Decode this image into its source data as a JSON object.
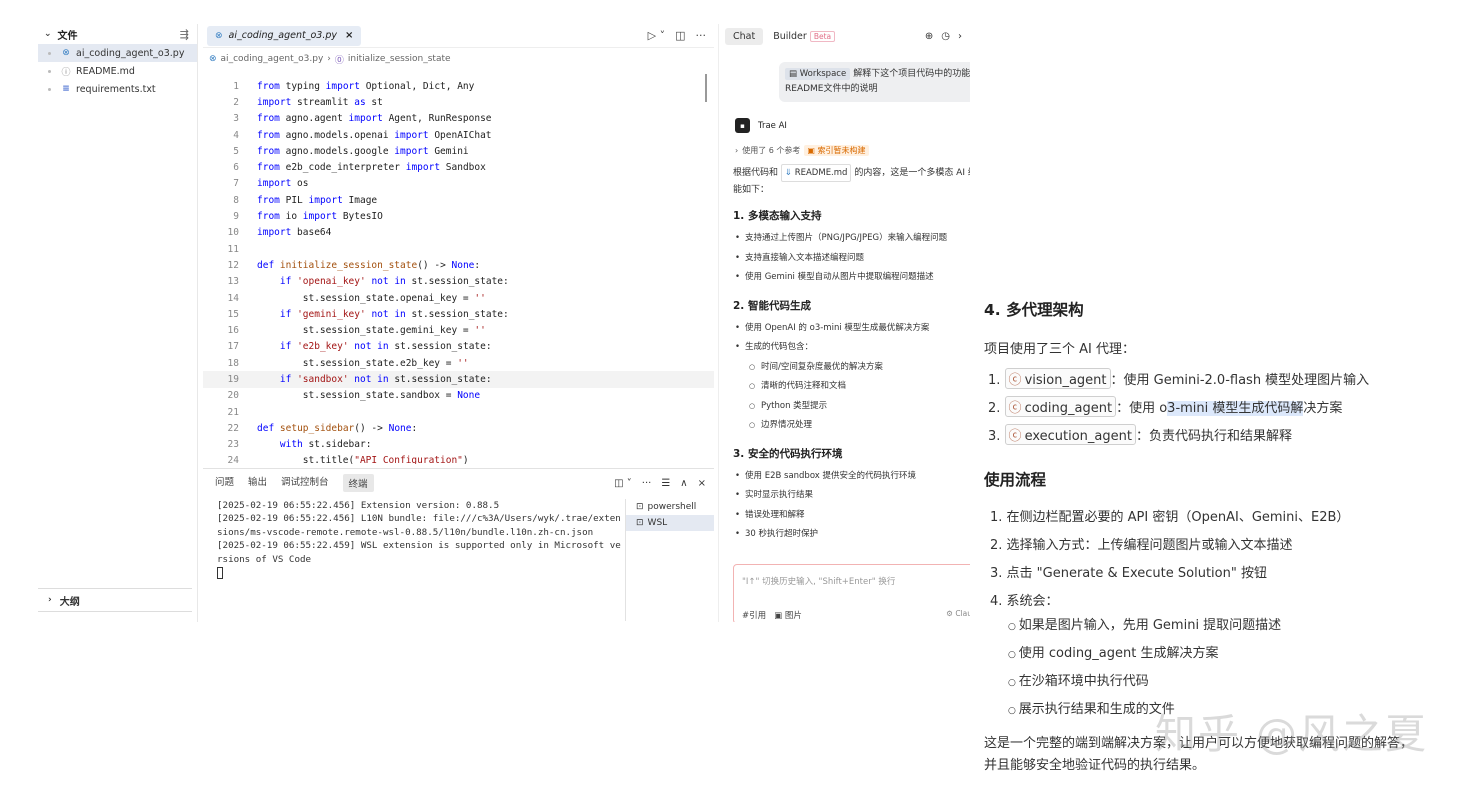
{
  "explorer": {
    "section_title": "文件",
    "files": [
      {
        "name": "ai_coding_agent_o3.py",
        "icon": "python-icon",
        "glyph": "⊗",
        "selected": true
      },
      {
        "name": "README.md",
        "icon": "info-icon",
        "glyph": "ⓘ",
        "selected": false
      },
      {
        "name": "requirements.txt",
        "icon": "text-file-icon",
        "glyph": "≡",
        "selected": false
      }
    ],
    "outline_label": "大纲"
  },
  "editor": {
    "tab_label": "ai_coding_agent_o3.py",
    "breadcrumb": {
      "file": "ai_coding_agent_o3.py",
      "symbol": "initialize_session_state"
    },
    "code_lines": [
      [
        {
          "t": "from",
          "c": "#0000ff"
        },
        {
          "t": " typing ",
          "c": "#222"
        },
        {
          "t": "import",
          "c": "#0000ff"
        },
        {
          "t": " Optional, Dict, Any",
          "c": "#222"
        }
      ],
      [
        {
          "t": "import",
          "c": "#0000ff"
        },
        {
          "t": " streamlit ",
          "c": "#222"
        },
        {
          "t": "as",
          "c": "#0000ff"
        },
        {
          "t": " st",
          "c": "#222"
        }
      ],
      [
        {
          "t": "from",
          "c": "#0000ff"
        },
        {
          "t": " agno.agent ",
          "c": "#222"
        },
        {
          "t": "import",
          "c": "#0000ff"
        },
        {
          "t": " Agent, RunResponse",
          "c": "#222"
        }
      ],
      [
        {
          "t": "from",
          "c": "#0000ff"
        },
        {
          "t": " agno.models.openai ",
          "c": "#222"
        },
        {
          "t": "import",
          "c": "#0000ff"
        },
        {
          "t": " OpenAIChat",
          "c": "#222"
        }
      ],
      [
        {
          "t": "from",
          "c": "#0000ff"
        },
        {
          "t": " agno.models.google ",
          "c": "#222"
        },
        {
          "t": "import",
          "c": "#0000ff"
        },
        {
          "t": " Gemini",
          "c": "#222"
        }
      ],
      [
        {
          "t": "from",
          "c": "#0000ff"
        },
        {
          "t": " e2b_code_interpreter ",
          "c": "#222"
        },
        {
          "t": "import",
          "c": "#0000ff"
        },
        {
          "t": " Sandbox",
          "c": "#222"
        }
      ],
      [
        {
          "t": "import",
          "c": "#0000ff"
        },
        {
          "t": " os",
          "c": "#222"
        }
      ],
      [
        {
          "t": "from",
          "c": "#0000ff"
        },
        {
          "t": " PIL ",
          "c": "#222"
        },
        {
          "t": "import",
          "c": "#0000ff"
        },
        {
          "t": " Image",
          "c": "#222"
        }
      ],
      [
        {
          "t": "from",
          "c": "#0000ff"
        },
        {
          "t": " io ",
          "c": "#222"
        },
        {
          "t": "import",
          "c": "#0000ff"
        },
        {
          "t": " BytesIO",
          "c": "#222"
        }
      ],
      [
        {
          "t": "import",
          "c": "#0000ff"
        },
        {
          "t": " base64",
          "c": "#222"
        }
      ],
      [],
      [
        {
          "t": "def",
          "c": "#0000ff"
        },
        {
          "t": " ",
          "c": "#222"
        },
        {
          "t": "initialize_session_state",
          "c": "#a3510f"
        },
        {
          "t": "() -> ",
          "c": "#222"
        },
        {
          "t": "None",
          "c": "#0000ff"
        },
        {
          "t": ":",
          "c": "#222"
        }
      ],
      [
        {
          "t": "    ",
          "c": "#222"
        },
        {
          "t": "if",
          "c": "#0000ff"
        },
        {
          "t": " ",
          "c": "#222"
        },
        {
          "t": "'openai_key'",
          "c": "#a31515"
        },
        {
          "t": " ",
          "c": "#222"
        },
        {
          "t": "not in",
          "c": "#0000ff"
        },
        {
          "t": " st.session_state:",
          "c": "#222"
        }
      ],
      [
        {
          "t": "        st.session_state.openai_key = ",
          "c": "#222"
        },
        {
          "t": "''",
          "c": "#a31515"
        }
      ],
      [
        {
          "t": "    ",
          "c": "#222"
        },
        {
          "t": "if",
          "c": "#0000ff"
        },
        {
          "t": " ",
          "c": "#222"
        },
        {
          "t": "'gemini_key'",
          "c": "#a31515"
        },
        {
          "t": " ",
          "c": "#222"
        },
        {
          "t": "not in",
          "c": "#0000ff"
        },
        {
          "t": " st.session_state:",
          "c": "#222"
        }
      ],
      [
        {
          "t": "        st.session_state.gemini_key = ",
          "c": "#222"
        },
        {
          "t": "''",
          "c": "#a31515"
        }
      ],
      [
        {
          "t": "    ",
          "c": "#222"
        },
        {
          "t": "if",
          "c": "#0000ff"
        },
        {
          "t": " ",
          "c": "#222"
        },
        {
          "t": "'e2b_key'",
          "c": "#a31515"
        },
        {
          "t": " ",
          "c": "#222"
        },
        {
          "t": "not in",
          "c": "#0000ff"
        },
        {
          "t": " st.session_state:",
          "c": "#222"
        }
      ],
      [
        {
          "t": "        st.session_state.e2b_key = ",
          "c": "#222"
        },
        {
          "t": "''",
          "c": "#a31515"
        }
      ],
      [
        {
          "t": "    ",
          "c": "#222"
        },
        {
          "t": "if",
          "c": "#0000ff"
        },
        {
          "t": " ",
          "c": "#222"
        },
        {
          "t": "'sandbox'",
          "c": "#a31515"
        },
        {
          "t": " ",
          "c": "#222"
        },
        {
          "t": "not in",
          "c": "#0000ff"
        },
        {
          "t": " st.session_state:",
          "c": "#222"
        }
      ],
      [
        {
          "t": "        st.session_state.sandbox = ",
          "c": "#222"
        },
        {
          "t": "None",
          "c": "#0000ff"
        }
      ],
      [],
      [
        {
          "t": "def",
          "c": "#0000ff"
        },
        {
          "t": " ",
          "c": "#222"
        },
        {
          "t": "setup_sidebar",
          "c": "#a3510f"
        },
        {
          "t": "() -> ",
          "c": "#222"
        },
        {
          "t": "None",
          "c": "#0000ff"
        },
        {
          "t": ":",
          "c": "#222"
        }
      ],
      [
        {
          "t": "    ",
          "c": "#222"
        },
        {
          "t": "with",
          "c": "#0000ff"
        },
        {
          "t": " st.sidebar:",
          "c": "#222"
        }
      ],
      [
        {
          "t": "        st.title(",
          "c": "#222"
        },
        {
          "t": "\"API Configuration\"",
          "c": "#a31515"
        },
        {
          "t": ")",
          "c": "#222"
        }
      ]
    ],
    "active_line": 19
  },
  "panel": {
    "tabs": [
      {
        "label": "问题",
        "active": false
      },
      {
        "label": "输出",
        "active": false
      },
      {
        "label": "调试控制台",
        "active": false
      },
      {
        "label": "终端",
        "active": true
      }
    ],
    "terminal_lines": [
      "[2025-02-19 06:55:22.456] Extension version: 0.88.5",
      "[2025-02-19 06:55:22.456] L10N bundle: file:///c%3A/Users/wyk/.trae/extensions/ms-vscode-remote.remote-wsl-0.88.5/l10n/bundle.l10n.zh-cn.json",
      "[2025-02-19 06:55:22.459] WSL extension is supported only in Microsoft versions of VS Code"
    ],
    "terminals": [
      {
        "name": "powershell",
        "selected": false
      },
      {
        "name": "WSL",
        "selected": true
      }
    ]
  },
  "chat": {
    "tab_chat": "Chat",
    "tab_builder": "Builder",
    "beta_badge": "Beta",
    "user_message": {
      "workspace_chip": "Workspace",
      "text": "解释下这个项目代码中的功能是什么？可以参考README文件中的说明"
    },
    "assistant_name": "Trae AI",
    "references": "使用了 6 个参考",
    "index_warning": "索引暂未构建",
    "intro_before": "根据代码和",
    "intro_chip": "README.md",
    "intro_after": "的内容，这是一个多模态 AI 编程助手项目，主要功能如下：",
    "sections": [
      {
        "title": "1. 多模态输入支持",
        "items": [
          {
            "text": "支持通过上传图片（PNG/JPG/JPEG）来输入编程问题",
            "sub": false
          },
          {
            "text": "支持直接输入文本描述编程问题",
            "sub": false
          },
          {
            "text": "使用 Gemini 模型自动从图片中提取编程问题描述",
            "sub": false
          }
        ]
      },
      {
        "title": "2. 智能代码生成",
        "items": [
          {
            "text": "使用 OpenAI 的 o3-mini 模型生成最优解决方案",
            "sub": false
          },
          {
            "text": "生成的代码包含：",
            "sub": false
          },
          {
            "text": "时间/空间复杂度最优的解决方案",
            "sub": true
          },
          {
            "text": "清晰的代码注释和文档",
            "sub": true
          },
          {
            "text": "Python 类型提示",
            "sub": true
          },
          {
            "text": "边界情况处理",
            "sub": true
          }
        ]
      },
      {
        "title": "3. 安全的代码执行环境",
        "items": [
          {
            "text": "使用 E2B sandbox 提供安全的代码执行环境",
            "sub": false
          },
          {
            "text": "实时显示执行结果",
            "sub": false
          },
          {
            "text": "错误处理和解释",
            "sub": false
          },
          {
            "text": "30 秒执行超时保护",
            "sub": false
          }
        ]
      }
    ],
    "input_placeholder": "\"I↑\" 切换历史输入, \"Shift+Enter\" 换行",
    "input_ref": "#引用",
    "input_image": "图片",
    "model_label": "Clau"
  },
  "zoom": {
    "section4_title": "4. 多代理架构",
    "section4_intro": "项目使用了三个 AI 代理：",
    "agents": [
      {
        "num": "1.",
        "name": "vision_agent",
        "desc": "：使用 Gemini-2.0-flash 模型处理图片输入",
        "hl": ""
      },
      {
        "num": "2.",
        "name": "coding_agent",
        "desc_before": "：使用 o",
        "hl": "3-mini 模型生成代码解",
        "desc": "决方案"
      },
      {
        "num": "3.",
        "name": "execution_agent",
        "desc": "：负责代码执行和结果解释",
        "hl": ""
      }
    ],
    "usage_title": "使用流程",
    "steps": [
      "1. 在侧边栏配置必要的 API 密钥（OpenAI、Gemini、E2B）",
      "2. 选择输入方式：上传编程问题图片或输入文本描述",
      "3. 点击 \"Generate & Execute Solution\" 按钮",
      "4. 系统会："
    ],
    "substeps": [
      "如果是图片输入，先用 Gemini 提取问题描述",
      "使用 coding_agent 生成解决方案",
      "在沙箱环境中执行代码",
      "展示执行结果和生成的文件"
    ],
    "closing_1": "这是一个完整的端到端解决方案，让用户可以方便地获取编程问题的解答，",
    "closing_2": "并且能够安全地验证代码的执行结果。",
    "watermark": "知乎 @风之夏"
  }
}
